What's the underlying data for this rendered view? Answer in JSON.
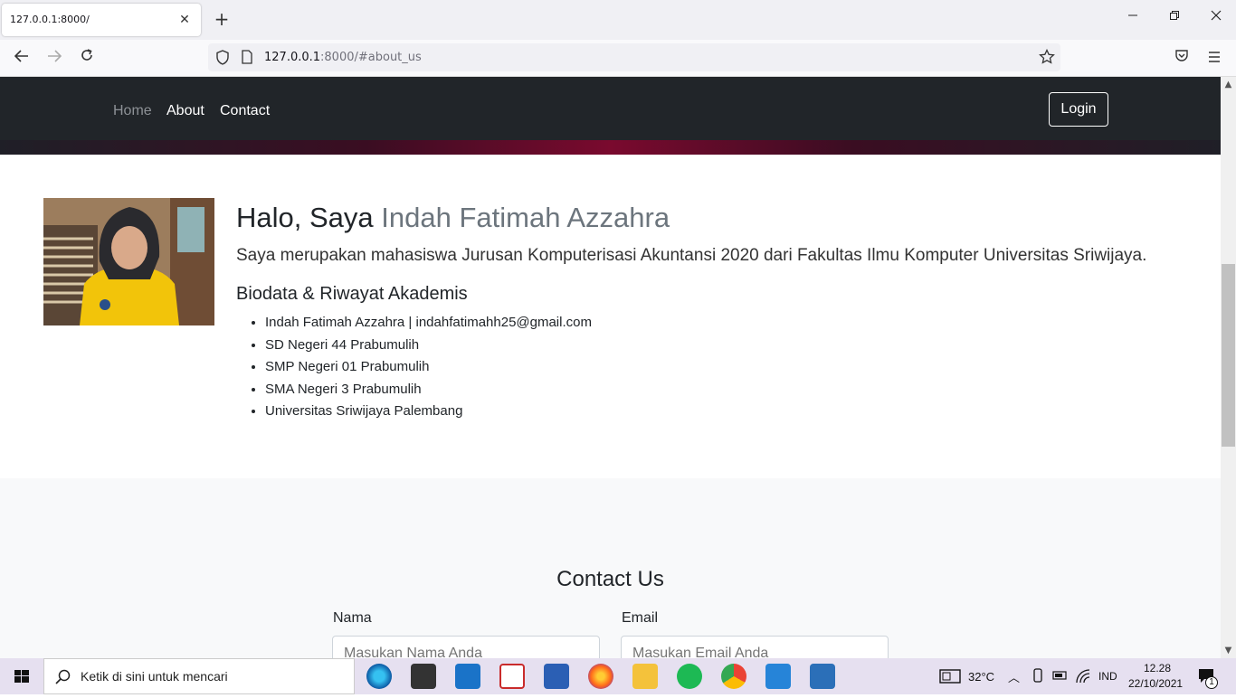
{
  "browser": {
    "tab_title": "127.0.0.1:8000/",
    "tab_close": "✕",
    "new_tab": "+",
    "url_host": "127.0.0.1",
    "url_path": ":8000/#about_us"
  },
  "site_nav": {
    "links": [
      {
        "label": "Home"
      },
      {
        "label": "About"
      },
      {
        "label": "Contact"
      }
    ],
    "login_label": "Login"
  },
  "about": {
    "greeting": "Halo, Saya ",
    "name": "Indah Fatimah Azzahra",
    "lead": "Saya merupakan mahasiswa Jurusan Komputerisasi Akuntansi 2020 dari Fakultas Ilmu Komputer Universitas Sriwijaya.",
    "subtitle": "Biodata & Riwayat Akademis",
    "items": [
      "Indah Fatimah Azzahra | indahfatimahh25@gmail.com",
      "SD Negeri 44 Prabumulih",
      "SMP Negeri 01 Prabumulih",
      "SMA Negeri 3 Prabumulih",
      "Universitas Sriwijaya Palembang"
    ]
  },
  "contact": {
    "title": "Contact Us",
    "name_label": "Nama",
    "name_placeholder": "Masukan Nama Anda",
    "email_label": "Email",
    "email_placeholder": "Masukan Email Anda"
  },
  "taskbar": {
    "search_placeholder": "Ketik di sini untuk mencari",
    "weather": "32°C",
    "language": "IND",
    "time": "12.28",
    "date": "22/10/2021",
    "notification_count": "1"
  },
  "colors": {
    "nav_bg": "#212529",
    "muted_text": "#6c757d",
    "accent_glow": "#7a0a2e"
  }
}
